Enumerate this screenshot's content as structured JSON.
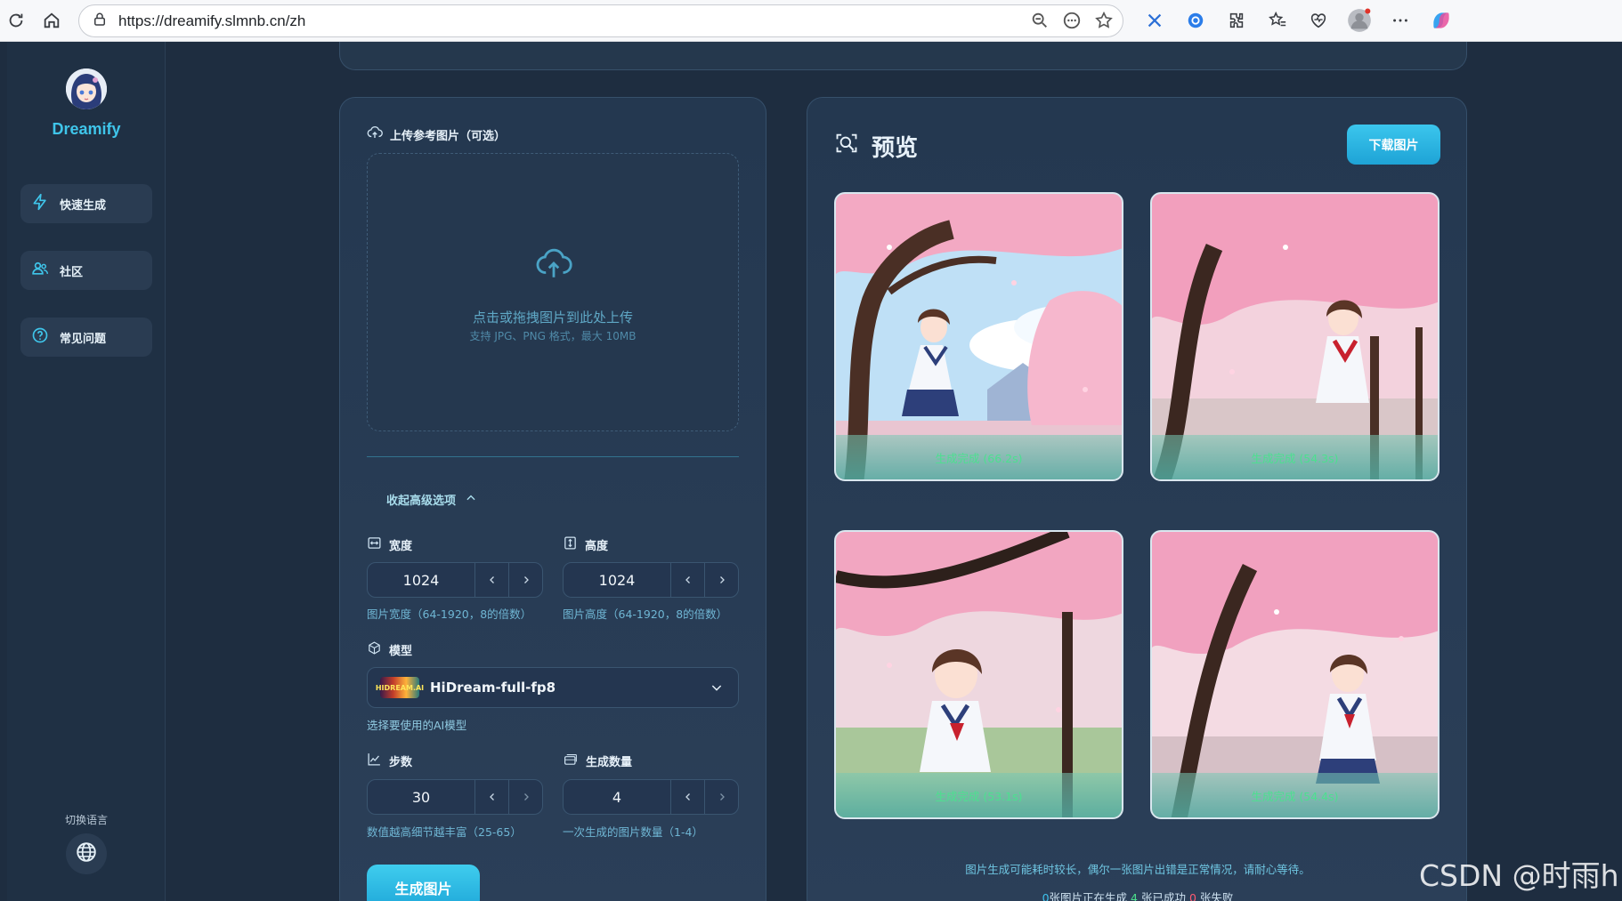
{
  "browser": {
    "url": "https://dreamify.slmnb.cn/zh"
  },
  "sidebar": {
    "brand": "Dreamify",
    "items": [
      {
        "label": "快速生成",
        "icon": "bolt-icon"
      },
      {
        "label": "社区",
        "icon": "users-icon"
      },
      {
        "label": "常见问题",
        "icon": "help-circle-icon"
      }
    ],
    "language_label": "切换语言"
  },
  "form": {
    "upload_title": "上传参考图片（可选）",
    "upload_main": "点击或拖拽图片到此处上传",
    "upload_sub": "支持 JPG、PNG 格式，最大 10MB",
    "advanced_toggle": "收起高级选项",
    "width": {
      "label": "宽度",
      "value": "1024",
      "hint": "图片宽度（64-1920，8的倍数）"
    },
    "height": {
      "label": "高度",
      "value": "1024",
      "hint": "图片高度（64-1920，8的倍数）"
    },
    "model": {
      "label": "模型",
      "thumb_text": "HIDREAM.AI",
      "value": "HiDream-full-fp8",
      "hint": "选择要使用的AI模型"
    },
    "steps": {
      "label": "步数",
      "value": "30",
      "hint": "数值越高细节越丰富（25-65）"
    },
    "count": {
      "label": "生成数量",
      "value": "4",
      "hint": "一次生成的图片数量（1-4）"
    },
    "generate_button": "生成图片"
  },
  "preview": {
    "title": "预览",
    "download_button": "下载图片",
    "images": [
      {
        "status": "生成完成 (66.2s)"
      },
      {
        "status": "生成完成 (54.3s)"
      },
      {
        "status": "生成完成 (53.1s)"
      },
      {
        "status": "生成完成 (54.4s)"
      }
    ],
    "notice": "图片生成可能耗时较长，偶尔一张图片出错是正常情况，请耐心等待。",
    "counts": {
      "generating_num": "0",
      "generating_label": "张图片正在生成",
      "success_num": "4",
      "success_label": "张已成功",
      "failed_num": "0",
      "failed_label": "张失败"
    }
  },
  "watermark": "CSDN @时雨h",
  "colors": {
    "accent": "#3fc5ea",
    "success": "#4be08c",
    "fail": "#ff5a72"
  }
}
